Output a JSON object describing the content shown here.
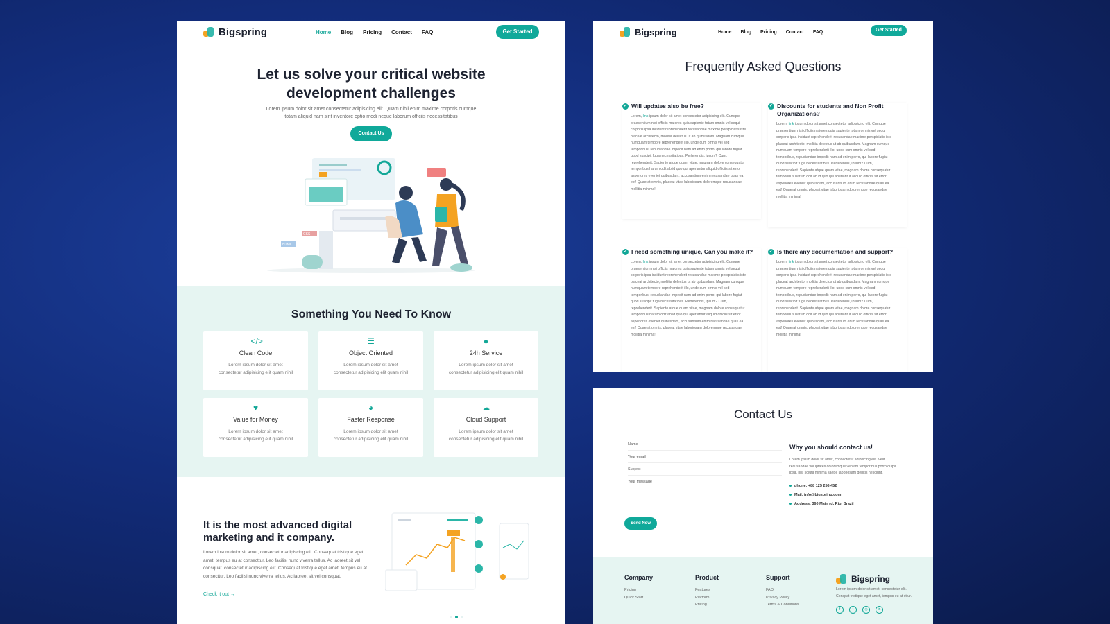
{
  "brand": "Bigspring",
  "nav": {
    "links": [
      "Home",
      "Blog",
      "Pricing",
      "Contact",
      "FAQ"
    ],
    "active": "Home",
    "cta": "Get Started"
  },
  "home": {
    "hero": {
      "title": "Let us solve your critical website development challenges",
      "subtitle": "Lorem ipsum dolor sit amet consectetur adipisicing elit. Quam nihil enim maxime corporis cumque totam aliquid nam sint inventore optio modi neque laborum officiis necessitatibus",
      "button": "Contact Us"
    },
    "features": {
      "title": "Something You Need To Know",
      "items": [
        {
          "icon": "code-icon",
          "title": "Clean Code",
          "desc": "Lorem ipsum dolor sit amet consectetur adipisicing elit quam nihil"
        },
        {
          "icon": "database-icon",
          "title": "Object Oriented",
          "desc": "Lorem ipsum dolor sit amet consectetur adipisicing elit quam nihil"
        },
        {
          "icon": "user-service-icon",
          "title": "24h Service",
          "desc": "Lorem ipsum dolor sit amet consectetur adipisicing elit quam nihil"
        },
        {
          "icon": "heart-icon",
          "title": "Value for Money",
          "desc": "Lorem ipsum dolor sit amet consectetur adipisicing elit quam nihil"
        },
        {
          "icon": "speedometer-icon",
          "title": "Faster Response",
          "desc": "Lorem ipsum dolor sit amet consectetur adipisicing elit quam nihil"
        },
        {
          "icon": "cloud-icon",
          "title": "Cloud Support",
          "desc": "Lorem ipsum dolor sit amet consectetur adipisicing elit quam nihil"
        }
      ]
    },
    "marketing": {
      "title": "It is the most advanced digital marketing and it company.",
      "desc": "Lorem ipsum dolor sit amet, consectetur adipiscing elit. Consequat tristique eget amet, tempus eu at consecttur. Leo facilisi nunc viverra tellus. Ac laoreet sit vel consquat. consectetur adipiscing elit. Consequat tristique eget amet, tempus eu at consecttur. Leo facilisi nunc viverra tellus. Ac laoreet sit vel consquat.",
      "link": "Check it out →"
    }
  },
  "faq": {
    "title": "Frequently Asked Questions",
    "answer_prefix": "Lorem,",
    "answer_link": "link",
    "answer_rest": "ipsum dolor sit amet consectetur adipisicing elit. Cumque praesentium nisi officiis maiores quia sapiente totam omnis vel sequi corporis ipsa incidunt reprehenderit recusandae maxime perspiciatis iste placeat architecto, mollitia delectus ut ab quibusdam. Magnam cumque numquam tempore reprehenderit illo, unde cum omnis vel sed temporibus, repudiandae impedit nam ad enim porro, qui labore fugiat quod suscipit fuga necessitatibus. Perferendis, ipsum? Cum, reprehenderit. Sapiente atque quam vitae, magnam dolore consequatur temporibus harum odit ab id quo qui aperiantur aliquid officiis sit error asperiores eveniet quibusdam, accusantium enim recusandae quas ea est! Quaerat omnis, placeat vitae laboriosam doloremque recusandae mollitia minima!",
    "items": [
      {
        "question": "Will updates also be free?"
      },
      {
        "question": "Discounts for students and Non Profit Organizations?"
      },
      {
        "question": "I need something unique, Can you make it?"
      },
      {
        "question": "Is there any documentation and support?"
      }
    ]
  },
  "contact": {
    "title": "Contact Us",
    "fields": {
      "name": "Name",
      "email": "Your email",
      "subject": "Subject",
      "message": "Your message"
    },
    "send": "Send Now",
    "why_title": "Why you should contact us!",
    "why_desc": "Lorem ipsum dolor sit amet, consectetur adipiscing elit. Velit recusandae voluptates doloremque veniam temporibus porro culpa ipsa, nisi soluta minima saepe laboriosam debitis nesciunt.",
    "info": [
      "phone: +88 125 256 452",
      "Mail: info@bigspring.com",
      "Address: 360 Main rd, Rio, Brazil"
    ]
  },
  "footer": {
    "columns": [
      {
        "title": "Company",
        "links": [
          "Pricing",
          "Quick Start"
        ]
      },
      {
        "title": "Product",
        "links": [
          "Features",
          "Platform",
          "Pricing"
        ]
      },
      {
        "title": "Support",
        "links": [
          "FAQ",
          "Privacy Policy",
          "Terms & Conditions"
        ]
      }
    ],
    "brand_desc": "Lorem ipsum dolor sit amet, consectetur elit. Conspat tristique eget amet, tempus eu at cttur."
  },
  "colors": {
    "accent": "#10a99a",
    "accent_light": "#e6f5f2",
    "logo_orange": "#f4a322",
    "background": "#122c7a"
  }
}
